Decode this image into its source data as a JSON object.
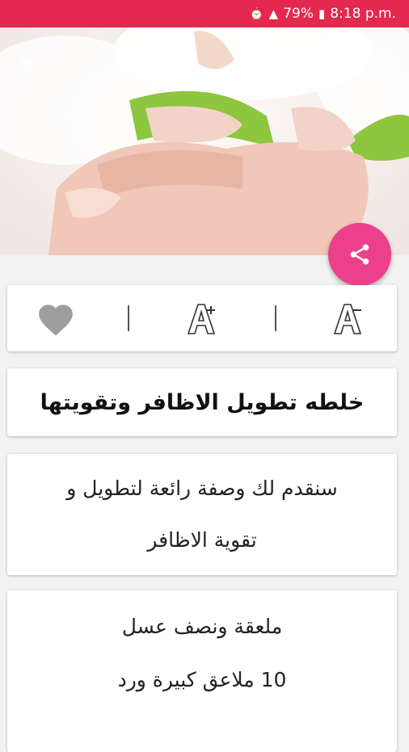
{
  "status_bar": {
    "battery": "79%",
    "time": "8:18 p.m."
  },
  "icons": {
    "alarm": "alarm-icon",
    "signal": "signal-icon",
    "battery": "battery-icon",
    "back": "arrow-left-icon",
    "menu": "menu-icon",
    "share": "share-icon",
    "favorite": "heart-icon",
    "font_increase": "font-increase-icon",
    "font_decrease": "font-decrease-icon"
  },
  "colors": {
    "status_bar": "#e5284f",
    "fab": "#ec3f8c",
    "heart": "#9e9e9e"
  },
  "article": {
    "title": "خلطه تطويل الاظافر وتقويتها",
    "intro_lines": [
      "سنقدم لك وصفة رائعة لتطويل و",
      "تقوية الاظافر"
    ],
    "ingredients": [
      "ملعقة ونصف عسل",
      "10 ملاعق كبيرة ورد"
    ]
  }
}
